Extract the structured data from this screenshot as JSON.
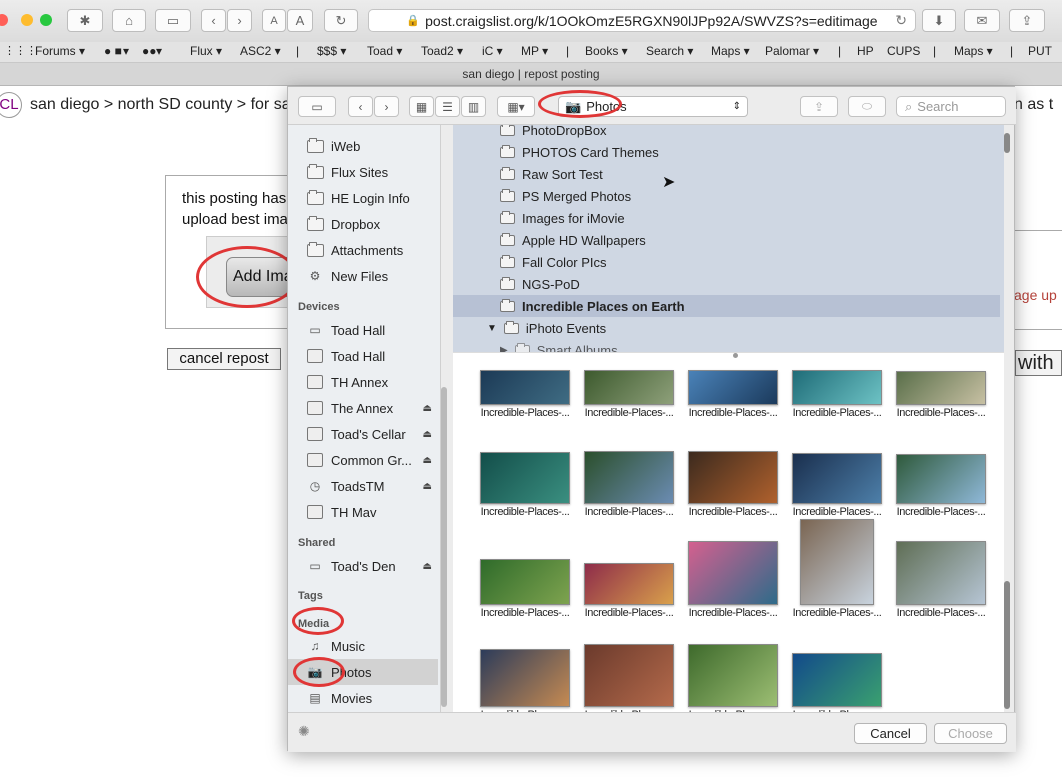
{
  "browser": {
    "url": "post.craigslist.org/k/1OOkOmzE5RGXN90lJPp92A/SWVZS?s=editimage",
    "tab_title": "san diego | repost posting",
    "font_small": "A",
    "font_large": "A",
    "bookmarks": [
      "Forums ▾",
      " ▾",
      " ▾",
      "Flux ▾",
      "ASC2 ▾",
      "|",
      "$$$ ▾",
      "Toad ▾",
      "Toad2 ▾",
      "iC ▾",
      "MP ▾",
      "|",
      "Books ▾",
      "Search ▾",
      "Maps ▾",
      "Palomar ▾",
      "|",
      "HP",
      "CUPS",
      "|",
      "Maps ▾",
      "|",
      "PUT"
    ]
  },
  "page": {
    "logo": "CL",
    "breadcrumb": "san diego > north SD county > for sa",
    "right_fragment_1": "n as t",
    "posting_text": "this posting has",
    "upload_text": "upload best ima",
    "add_image_button": "Add Ima",
    "cancel_repost": "cancel repost",
    "right_fragment_2": "age up",
    "right_fragment_3": "with"
  },
  "dialog": {
    "location": "Photos",
    "search_placeholder": "Search",
    "sidebar": {
      "favorites": [
        "iWeb",
        "Flux Sites",
        "HE Login Info",
        "Dropbox",
        "Attachments",
        "New Files"
      ],
      "devices_header": "Devices",
      "devices": [
        {
          "label": "Toad Hall",
          "eject": false
        },
        {
          "label": "Toad Hall",
          "eject": false
        },
        {
          "label": "TH Annex",
          "eject": false
        },
        {
          "label": "The Annex",
          "eject": true
        },
        {
          "label": "Toad's Cellar",
          "eject": true
        },
        {
          "label": "Common Gr...",
          "eject": true
        },
        {
          "label": "ToadsTM",
          "eject": true
        },
        {
          "label": "TH Mav",
          "eject": false
        }
      ],
      "shared_header": "Shared",
      "shared": [
        {
          "label": "Toad's Den",
          "eject": true
        }
      ],
      "tags_header": "Tags",
      "media_header": "Media",
      "media": [
        "Music",
        "Photos",
        "Movies"
      ]
    },
    "list_items": [
      "PhotoDropBox",
      "PHOTOS Card Themes",
      "Raw Sort Test",
      "PS Merged Photos",
      "Images for iMovie",
      "Apple HD Wallpapers",
      "Fall Color PIcs",
      "NGS-PoD",
      "Incredible Places on Earth",
      "iPhoto Events",
      "Smart Albums"
    ],
    "selected_item": "Incredible Places on Earth",
    "thumb_caption": "Incredible-Places-...",
    "thumbnails": [
      {
        "caption": "Incredible-Places-...",
        "colors": [
          "#1c3a56",
          "#3f6c83"
        ]
      },
      {
        "caption": "Incredible-Places-...",
        "colors": [
          "#3d5a2e",
          "#8ea07a"
        ]
      },
      {
        "caption": "Incredible-Places-...",
        "colors": [
          "#4a82b8",
          "#1b3a5c"
        ]
      },
      {
        "caption": "Incredible-Places-...",
        "colors": [
          "#1f6c78",
          "#6dc2c4"
        ]
      },
      {
        "caption": "Incredible-Places-...",
        "colors": [
          "#5a6f4a",
          "#c7c0a3"
        ]
      },
      {
        "caption": "Incredible-Places-...",
        "colors": [
          "#134e4a",
          "#3a8f80"
        ]
      },
      {
        "caption": "Incredible-Places-...",
        "colors": [
          "#2b4f2c",
          "#6b8cb2"
        ]
      },
      {
        "caption": "Incredible-Places-...",
        "colors": [
          "#3c2a1e",
          "#b0612d"
        ]
      },
      {
        "caption": "Incredible-Places-...",
        "colors": [
          "#1a2f4e",
          "#4d7fa9"
        ]
      },
      {
        "caption": "Incredible-Places-...",
        "colors": [
          "#2f5a3c",
          "#8fb8d8"
        ]
      },
      {
        "caption": "Incredible-Places-...",
        "colors": [
          "#2f6b2a",
          "#7ea34f"
        ]
      },
      {
        "caption": "Incredible-Places-...",
        "colors": [
          "#8e2c4a",
          "#d9a04b"
        ]
      },
      {
        "caption": "Incredible-Places-...",
        "colors": [
          "#d4608f",
          "#2e6b8a"
        ]
      },
      {
        "caption": "Incredible-Places-...",
        "colors": [
          "#7a6552",
          "#c8d3de"
        ]
      },
      {
        "caption": "Incredible-Places-...",
        "colors": [
          "#5f6e55",
          "#b6c5d4"
        ]
      },
      {
        "caption": "Incredible-Places-...",
        "colors": [
          "#2d3c5a",
          "#c58a52"
        ]
      },
      {
        "caption": "Incredible-Places-...",
        "colors": [
          "#6b3a2c",
          "#b46a4b"
        ]
      },
      {
        "caption": "Incredible-Places-...",
        "colors": [
          "#3e6a2c",
          "#9cbe73"
        ]
      },
      {
        "caption": "Incredible-Places-...",
        "colors": [
          "#124a8a",
          "#3aa070"
        ]
      }
    ],
    "cancel_button": "Cancel",
    "choose_button": "Choose"
  }
}
